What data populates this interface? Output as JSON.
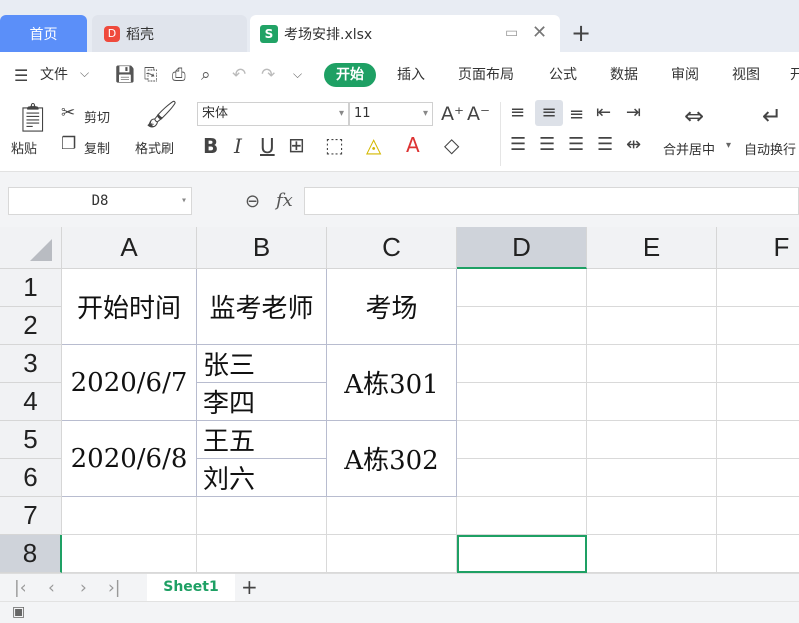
{
  "tabs": {
    "home": "首页",
    "daoke": "稻壳",
    "file": "考场安排.xlsx",
    "file_logo": "S",
    "daoke_logo": "D",
    "new_tab": "+"
  },
  "menu": {
    "file": "文件",
    "items": [
      "开始",
      "插入",
      "页面布局",
      "公式",
      "数据",
      "审阅",
      "视图",
      "开"
    ]
  },
  "toolbar": {
    "paste": "粘贴",
    "cut": "剪切",
    "copy": "复制",
    "format_painter": "格式刷",
    "font_name": "宋体",
    "font_size": "11",
    "merge_center": "合并居中",
    "auto_wrap": "自动换行"
  },
  "formula_bar": {
    "name_box": "D8",
    "fx": "fx",
    "value": ""
  },
  "grid": {
    "columns": [
      "A",
      "B",
      "C",
      "D",
      "E",
      "F"
    ],
    "rows": [
      "1",
      "2",
      "3",
      "4",
      "5",
      "6",
      "7",
      "8"
    ],
    "cells": {
      "a1": "开始时间",
      "b1": "监考老师",
      "c1": "考场",
      "a3": "2020/6/7",
      "b3": "张三",
      "b4": "李四",
      "c3": "A栋301",
      "a5": "2020/6/8",
      "b5": "王五",
      "b6": "刘六",
      "c5": "A栋302"
    },
    "active_cell": "D8"
  },
  "sheets": {
    "active": "Sheet1",
    "add": "+"
  },
  "colors": {
    "accent": "#1ea064",
    "home_tab": "#5b8ff9"
  }
}
